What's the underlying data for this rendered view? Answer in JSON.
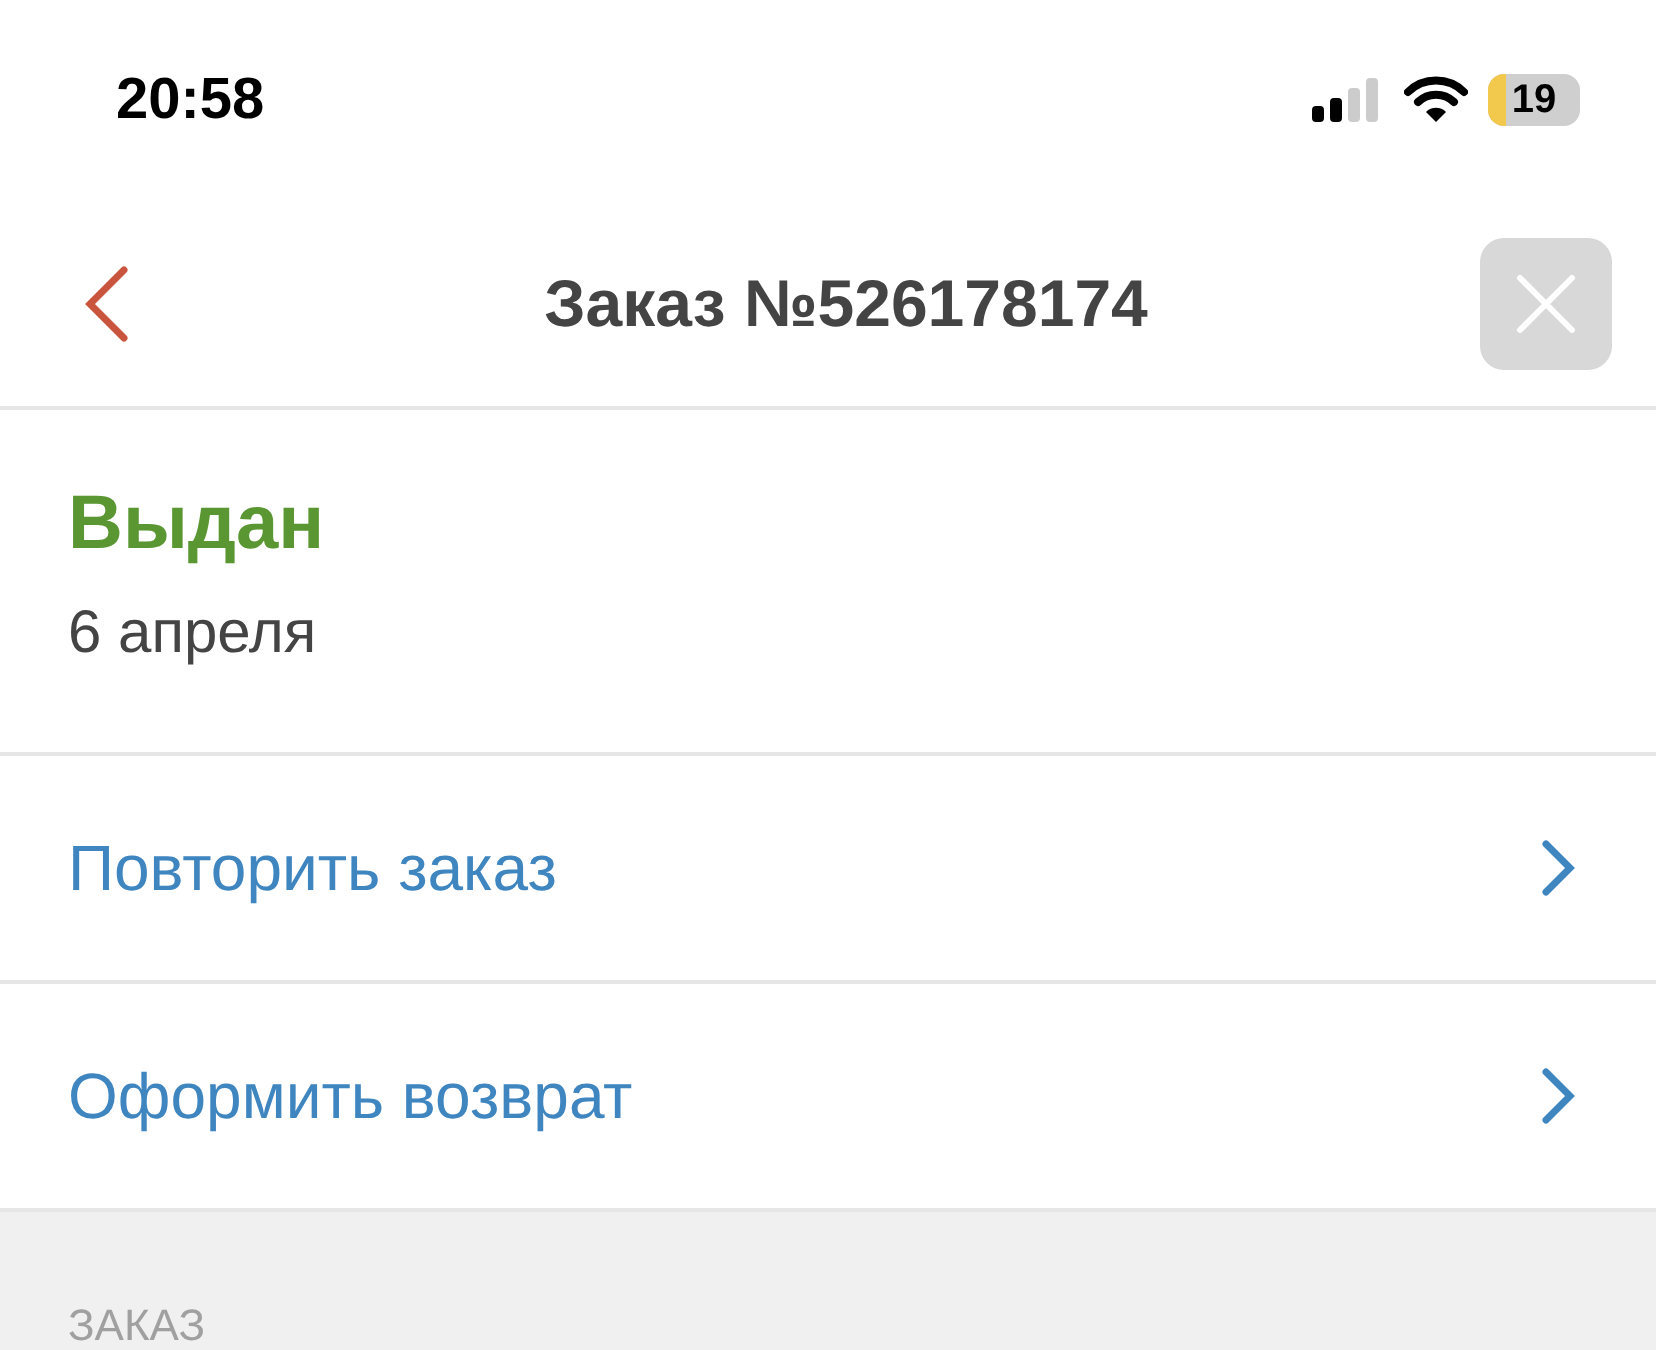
{
  "status_bar": {
    "time": "20:58",
    "battery": "19"
  },
  "header": {
    "title": "Заказ №526178174"
  },
  "order_status": {
    "title": "Выдан",
    "date": "6 апреля"
  },
  "actions": [
    {
      "label": "Повторить заказ"
    },
    {
      "label": "Оформить возврат"
    }
  ],
  "section": {
    "title": "ЗАКАЗ"
  }
}
